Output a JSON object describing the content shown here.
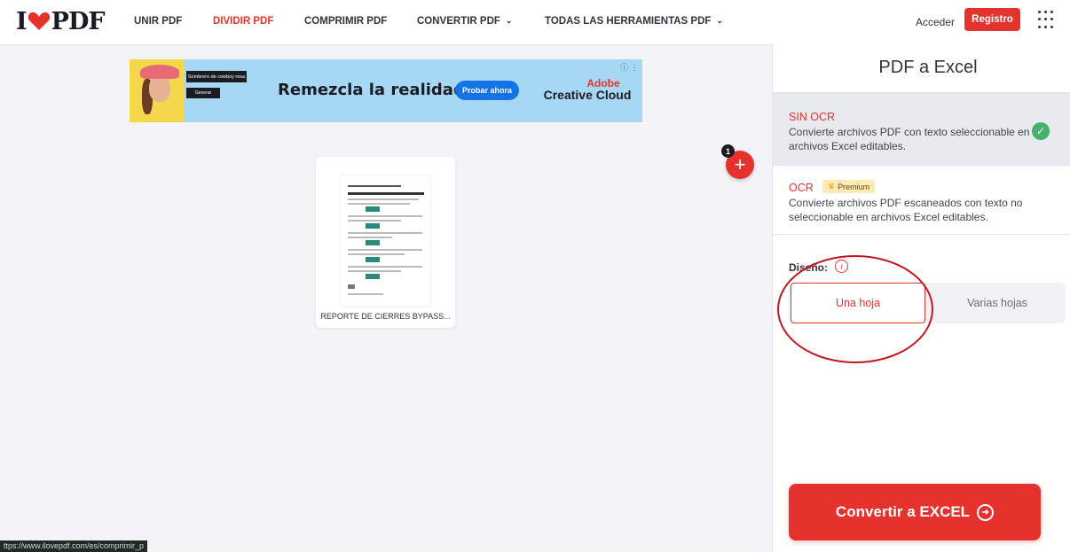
{
  "header": {
    "logo": {
      "left": "I",
      "right": "PDF"
    },
    "nav": [
      {
        "label": "UNIR PDF"
      },
      {
        "label": "DIVIDIR PDF"
      },
      {
        "label": "COMPRIMIR PDF"
      },
      {
        "label": "CONVERTIR PDF"
      },
      {
        "label": "TODAS LAS HERRAMIENTAS PDF"
      }
    ],
    "login": "Acceder",
    "register": "Registro",
    "apps_icon": "grid-icon"
  },
  "ad": {
    "box1": "Sombrero de cowboy rosa",
    "box2": "Generar",
    "headline": "Remezcla la realidad",
    "cta": "Probar ahora",
    "brand_line1": "Adobe",
    "brand_line2": "Creative Cloud",
    "icons": "ⓘ ⋮"
  },
  "file": {
    "name": "REPORTE DE CIERRES BYPASS..."
  },
  "add": {
    "badge": "1",
    "icon": "plus-icon"
  },
  "panel": {
    "title": "PDF a Excel",
    "options": [
      {
        "title": "SIN OCR",
        "desc": "Convierte archivos PDF con texto seleccionable en archivos Excel editables.",
        "selected": true
      },
      {
        "title": "OCR",
        "badge": "Premium",
        "desc": "Convierte archivos PDF escaneados con texto no seleccionable en archivos Excel editables.",
        "selected": false
      }
    ],
    "layout_label": "Diseño:",
    "layout_options": [
      "Una hoja",
      "Varias hojas"
    ],
    "layout_selected": "Una hoja",
    "convert_label": "Convertir a EXCEL"
  },
  "status_url": "ttps://www.ilovepdf.com/es/comprimir_p"
}
